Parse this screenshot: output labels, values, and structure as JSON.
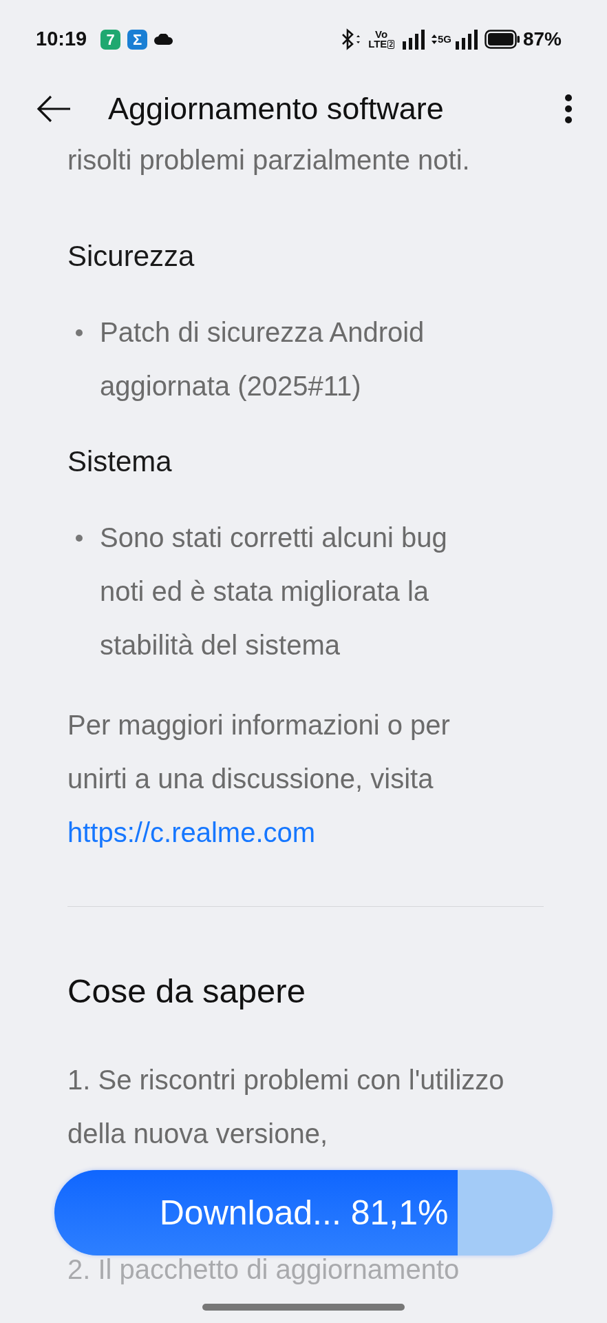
{
  "status_bar": {
    "time": "10:19",
    "notification_icons": [
      {
        "glyph": "7",
        "color": "#1fa870"
      },
      {
        "glyph": "Σ",
        "color": "#1a7fd4"
      }
    ],
    "volte": {
      "top": "Vo",
      "bottom": "LTE",
      "sim": "2"
    },
    "network": "5G",
    "battery": "87%"
  },
  "app_bar": {
    "title": "Aggiornamento software"
  },
  "content": {
    "cut_line": "risolti problemi parzialmente noti.",
    "sections": [
      {
        "heading": "Sicurezza",
        "bullets": [
          "Patch di sicurezza Android aggiornata (2025#11)"
        ]
      },
      {
        "heading": "Sistema",
        "bullets": [
          "Sono stati corretti alcuni bug noti ed è stata migliorata la stabilità del sistema"
        ]
      }
    ],
    "more_info": "Per maggiori informazioni o per unirti a una discussione, visita",
    "link": "https://c.realme.com",
    "notes": {
      "heading": "Cose da sapere",
      "items": [
        {
          "text": "1. Se riscontri problemi con l'utilizzo della nuova versione,",
          "faded": false
        },
        {
          "text": "2. Il pacchetto di aggiornamento",
          "faded": true
        }
      ]
    }
  },
  "download_button": {
    "label": "Download... 81,1%",
    "level": 0.81
  }
}
